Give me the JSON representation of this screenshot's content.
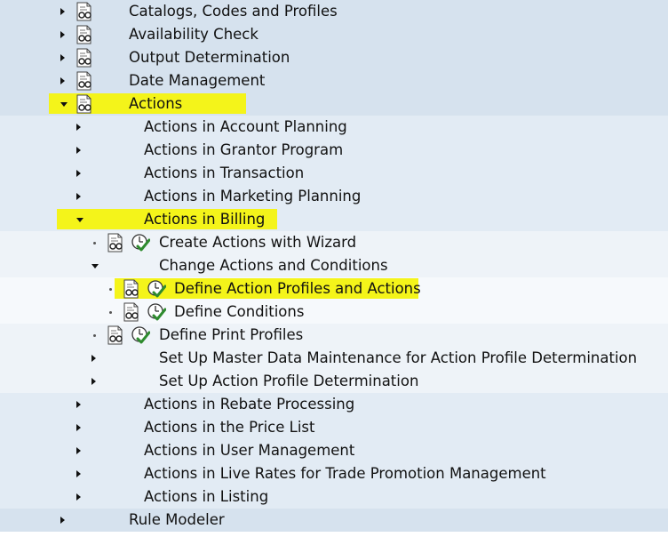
{
  "tree": {
    "nodes": [
      {
        "label": "Catalogs, Codes and Profiles",
        "state": "collapsed",
        "doc": true,
        "exec": false,
        "level": 1
      },
      {
        "label": "Availability Check",
        "state": "collapsed",
        "doc": true,
        "exec": false,
        "level": 1
      },
      {
        "label": "Output Determination",
        "state": "collapsed",
        "doc": true,
        "exec": false,
        "level": 1
      },
      {
        "label": "Date Management",
        "state": "collapsed",
        "doc": true,
        "exec": false,
        "level": 1
      },
      {
        "label": "Actions",
        "state": "expanded",
        "doc": true,
        "exec": false,
        "level": 1,
        "highlight": true
      },
      {
        "label": "Actions in Account Planning",
        "state": "collapsed",
        "doc": false,
        "exec": false,
        "level": 2
      },
      {
        "label": "Actions in Grantor Program",
        "state": "collapsed",
        "doc": false,
        "exec": false,
        "level": 2
      },
      {
        "label": "Actions in Transaction",
        "state": "collapsed",
        "doc": false,
        "exec": false,
        "level": 2
      },
      {
        "label": "Actions in Marketing Planning",
        "state": "collapsed",
        "doc": false,
        "exec": false,
        "level": 2
      },
      {
        "label": "Actions in Billing",
        "state": "expanded",
        "doc": false,
        "exec": false,
        "level": 2,
        "highlight": true
      },
      {
        "label": "Create Actions with Wizard",
        "state": "leaf",
        "doc": true,
        "exec": true,
        "level": 3
      },
      {
        "label": "Change Actions and Conditions",
        "state": "expanded",
        "doc": false,
        "exec": false,
        "level": 3
      },
      {
        "label": "Define Action Profiles and Actions",
        "state": "leaf",
        "doc": true,
        "exec": true,
        "level": 4,
        "highlight": true
      },
      {
        "label": "Define Conditions",
        "state": "leaf",
        "doc": true,
        "exec": true,
        "level": 4
      },
      {
        "label": "Define Print Profiles",
        "state": "leaf",
        "doc": true,
        "exec": true,
        "level": 3
      },
      {
        "label": "Set Up Master Data Maintenance for Action Profile Determination",
        "state": "collapsed",
        "doc": false,
        "exec": false,
        "level": 3
      },
      {
        "label": "Set Up Action Profile Determination",
        "state": "collapsed",
        "doc": false,
        "exec": false,
        "level": 3
      },
      {
        "label": "Actions in Rebate Processing",
        "state": "collapsed",
        "doc": false,
        "exec": false,
        "level": 2
      },
      {
        "label": "Actions in the Price List",
        "state": "collapsed",
        "doc": false,
        "exec": false,
        "level": 2
      },
      {
        "label": "Actions in User Management",
        "state": "collapsed",
        "doc": false,
        "exec": false,
        "level": 2
      },
      {
        "label": "Actions in Live Rates for Trade Promotion Management",
        "state": "collapsed",
        "doc": false,
        "exec": false,
        "level": 2
      },
      {
        "label": "Actions in Listing",
        "state": "collapsed",
        "doc": false,
        "exec": false,
        "level": 2
      },
      {
        "label": "Rule Modeler",
        "state": "collapsed",
        "doc": false,
        "exec": false,
        "level": 1
      }
    ]
  },
  "colors": {
    "highlight": "#f4f41a",
    "level1_bg": "#d6e2ee",
    "level2_bg": "#e2ebf4",
    "level3_bg": "#eef3f8",
    "level4_bg": "#f6f9fc",
    "exec_check": "#2e8b2e"
  },
  "icons": {
    "doc": "documentation-glasses-icon",
    "exec": "execute-clock-check-icon",
    "collapsed": "triangle-right-icon",
    "expanded": "triangle-down-icon",
    "leaf": "bullet-icon"
  }
}
